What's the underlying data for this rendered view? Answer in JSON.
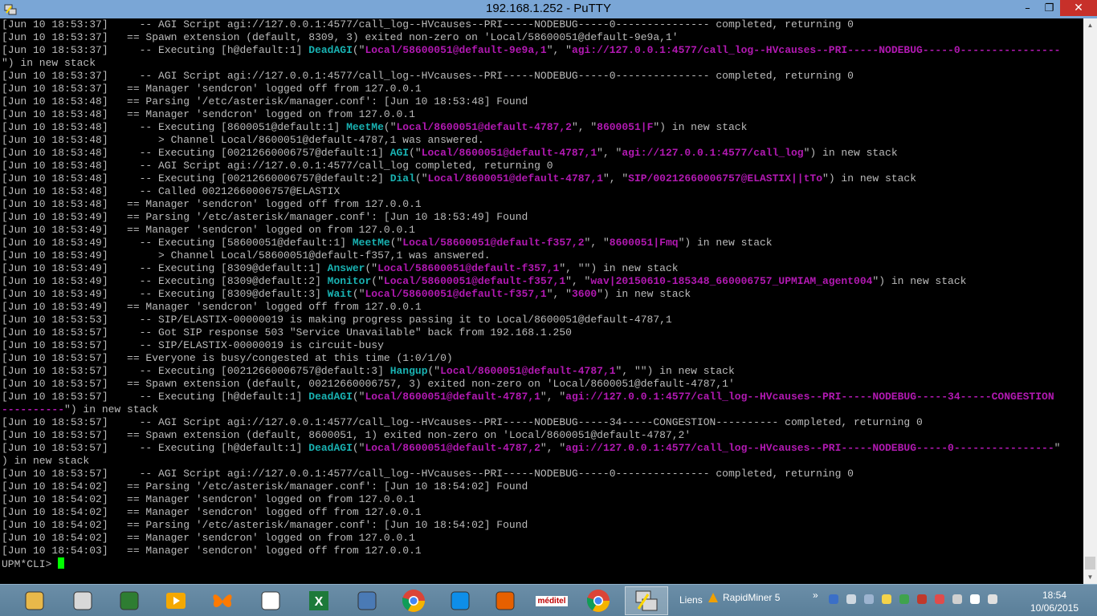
{
  "window": {
    "title": "192.168.1.252 - PuTTY"
  },
  "controls": {
    "minimize": "–",
    "restore": "❐",
    "close": "✕"
  },
  "colors": {
    "keyword": "#19b2b2",
    "argument": "#b219b2",
    "text": "#bbbbbb",
    "cursor": "#00ff00"
  },
  "terminal": {
    "prompt": "UPM*CLI> ",
    "lines": [
      [
        [
          "t",
          "[Jun 10 18:53:37]     -- AGI Script agi://127.0.0.1:4577/call_log--HVcauses--PRI-----NODEBUG-----0--------------- completed, returning 0"
        ]
      ],
      [
        [
          "t",
          "[Jun 10 18:53:37]   == Spawn extension (default, 8309, 3) exited non-zero on 'Local/58600051@default-9e9a,1'"
        ]
      ],
      [
        [
          "t",
          "[Jun 10 18:53:37]     -- Executing [h@default:1] "
        ],
        [
          "k",
          "DeadAGI"
        ],
        [
          "t",
          "(\""
        ],
        [
          "a",
          "Local/58600051@default-9e9a,1"
        ],
        [
          "t",
          "\", \""
        ],
        [
          "a",
          "agi://127.0.0.1:4577/call_log--HVcauses--PRI-----NODEBUG-----0----------------"
        ]
      ],
      [
        [
          "t",
          "\") in new stack"
        ]
      ],
      [
        [
          "t",
          "[Jun 10 18:53:37]     -- AGI Script agi://127.0.0.1:4577/call_log--HVcauses--PRI-----NODEBUG-----0--------------- completed, returning 0"
        ]
      ],
      [
        [
          "t",
          "[Jun 10 18:53:37]   == Manager 'sendcron' logged off from 127.0.0.1"
        ]
      ],
      [
        [
          "t",
          "[Jun 10 18:53:48]   == Parsing '/etc/asterisk/manager.conf': [Jun 10 18:53:48] Found"
        ]
      ],
      [
        [
          "t",
          "[Jun 10 18:53:48]   == Manager 'sendcron' logged on from 127.0.0.1"
        ]
      ],
      [
        [
          "t",
          "[Jun 10 18:53:48]     -- Executing [8600051@default:1] "
        ],
        [
          "k",
          "MeetMe"
        ],
        [
          "t",
          "(\""
        ],
        [
          "a",
          "Local/8600051@default-4787,2"
        ],
        [
          "t",
          "\", \""
        ],
        [
          "a",
          "8600051|F"
        ],
        [
          "t",
          "\") in new stack"
        ]
      ],
      [
        [
          "t",
          "[Jun 10 18:53:48]        > Channel Local/8600051@default-4787,1 was answered."
        ]
      ],
      [
        [
          "t",
          "[Jun 10 18:53:48]     -- Executing [00212660006757@default:1] "
        ],
        [
          "k",
          "AGI"
        ],
        [
          "t",
          "(\""
        ],
        [
          "a",
          "Local/8600051@default-4787,1"
        ],
        [
          "t",
          "\", \""
        ],
        [
          "a",
          "agi://127.0.0.1:4577/call_log"
        ],
        [
          "t",
          "\") in new stack"
        ]
      ],
      [
        [
          "t",
          "[Jun 10 18:53:48]     -- AGI Script agi://127.0.0.1:4577/call_log completed, returning 0"
        ]
      ],
      [
        [
          "t",
          "[Jun 10 18:53:48]     -- Executing [00212660006757@default:2] "
        ],
        [
          "k",
          "Dial"
        ],
        [
          "t",
          "(\""
        ],
        [
          "a",
          "Local/8600051@default-4787,1"
        ],
        [
          "t",
          "\", \""
        ],
        [
          "a",
          "SIP/00212660006757@ELASTIX||tTo"
        ],
        [
          "t",
          "\") in new stack"
        ]
      ],
      [
        [
          "t",
          "[Jun 10 18:53:48]     -- Called 00212660006757@ELASTIX"
        ]
      ],
      [
        [
          "t",
          "[Jun 10 18:53:48]   == Manager 'sendcron' logged off from 127.0.0.1"
        ]
      ],
      [
        [
          "t",
          "[Jun 10 18:53:49]   == Parsing '/etc/asterisk/manager.conf': [Jun 10 18:53:49] Found"
        ]
      ],
      [
        [
          "t",
          "[Jun 10 18:53:49]   == Manager 'sendcron' logged on from 127.0.0.1"
        ]
      ],
      [
        [
          "t",
          "[Jun 10 18:53:49]     -- Executing [58600051@default:1] "
        ],
        [
          "k",
          "MeetMe"
        ],
        [
          "t",
          "(\""
        ],
        [
          "a",
          "Local/58600051@default-f357,2"
        ],
        [
          "t",
          "\", \""
        ],
        [
          "a",
          "8600051|Fmq"
        ],
        [
          "t",
          "\") in new stack"
        ]
      ],
      [
        [
          "t",
          "[Jun 10 18:53:49]        > Channel Local/58600051@default-f357,1 was answered."
        ]
      ],
      [
        [
          "t",
          "[Jun 10 18:53:49]     -- Executing [8309@default:1] "
        ],
        [
          "k",
          "Answer"
        ],
        [
          "t",
          "(\""
        ],
        [
          "a",
          "Local/58600051@default-f357,1"
        ],
        [
          "t",
          "\", \"\") in new stack"
        ]
      ],
      [
        [
          "t",
          "[Jun 10 18:53:49]     -- Executing [8309@default:2] "
        ],
        [
          "k",
          "Monitor"
        ],
        [
          "t",
          "(\""
        ],
        [
          "a",
          "Local/58600051@default-f357,1"
        ],
        [
          "t",
          "\", \""
        ],
        [
          "a",
          "wav|20150610-185348_660006757_UPMIAM_agent004"
        ],
        [
          "t",
          "\") in new stack"
        ]
      ],
      [
        [
          "t",
          "[Jun 10 18:53:49]     -- Executing [8309@default:3] "
        ],
        [
          "k",
          "Wait"
        ],
        [
          "t",
          "(\""
        ],
        [
          "a",
          "Local/58600051@default-f357,1"
        ],
        [
          "t",
          "\", \""
        ],
        [
          "a",
          "3600"
        ],
        [
          "t",
          "\") in new stack"
        ]
      ],
      [
        [
          "t",
          "[Jun 10 18:53:49]   == Manager 'sendcron' logged off from 127.0.0.1"
        ]
      ],
      [
        [
          "t",
          "[Jun 10 18:53:53]     -- SIP/ELASTIX-00000019 is making progress passing it to Local/8600051@default-4787,1"
        ]
      ],
      [
        [
          "t",
          "[Jun 10 18:53:57]     -- Got SIP response 503 \"Service Unavailable\" back from 192.168.1.250"
        ]
      ],
      [
        [
          "t",
          "[Jun 10 18:53:57]     -- SIP/ELASTIX-00000019 is circuit-busy"
        ]
      ],
      [
        [
          "t",
          "[Jun 10 18:53:57]   == Everyone is busy/congested at this time (1:0/1/0)"
        ]
      ],
      [
        [
          "t",
          "[Jun 10 18:53:57]     -- Executing [00212660006757@default:3] "
        ],
        [
          "k",
          "Hangup"
        ],
        [
          "t",
          "(\""
        ],
        [
          "a",
          "Local/8600051@default-4787,1"
        ],
        [
          "t",
          "\", \"\") in new stack"
        ]
      ],
      [
        [
          "t",
          "[Jun 10 18:53:57]   == Spawn extension (default, 00212660006757, 3) exited non-zero on 'Local/8600051@default-4787,1'"
        ]
      ],
      [
        [
          "t",
          "[Jun 10 18:53:57]     -- Executing [h@default:1] "
        ],
        [
          "k",
          "DeadAGI"
        ],
        [
          "t",
          "(\""
        ],
        [
          "a",
          "Local/8600051@default-4787,1"
        ],
        [
          "t",
          "\", \""
        ],
        [
          "a",
          "agi://127.0.0.1:4577/call_log--HVcauses--PRI-----NODEBUG-----34-----CONGESTION"
        ]
      ],
      [
        [
          "a",
          "----------"
        ],
        [
          "t",
          "\") in new stack"
        ]
      ],
      [
        [
          "t",
          "[Jun 10 18:53:57]     -- AGI Script agi://127.0.0.1:4577/call_log--HVcauses--PRI-----NODEBUG-----34-----CONGESTION---------- completed, returning 0"
        ]
      ],
      [
        [
          "t",
          "[Jun 10 18:53:57]   == Spawn extension (default, 8600051, 1) exited non-zero on 'Local/8600051@default-4787,2'"
        ]
      ],
      [
        [
          "t",
          "[Jun 10 18:53:57]     -- Executing [h@default:1] "
        ],
        [
          "k",
          "DeadAGI"
        ],
        [
          "t",
          "(\""
        ],
        [
          "a",
          "Local/8600051@default-4787,2"
        ],
        [
          "t",
          "\", \""
        ],
        [
          "a",
          "agi://127.0.0.1:4577/call_log--HVcauses--PRI-----NODEBUG-----0----------------"
        ],
        [
          "t",
          "\""
        ]
      ],
      [
        [
          "t",
          ") in new stack"
        ]
      ],
      [
        [
          "t",
          "[Jun 10 18:53:57]     -- AGI Script agi://127.0.0.1:4577/call_log--HVcauses--PRI-----NODEBUG-----0--------------- completed, returning 0"
        ]
      ],
      [
        [
          "t",
          "[Jun 10 18:54:02]   == Parsing '/etc/asterisk/manager.conf': [Jun 10 18:54:02] Found"
        ]
      ],
      [
        [
          "t",
          "[Jun 10 18:54:02]   == Manager 'sendcron' logged on from 127.0.0.1"
        ]
      ],
      [
        [
          "t",
          "[Jun 10 18:54:02]   == Manager 'sendcron' logged off from 127.0.0.1"
        ]
      ],
      [
        [
          "t",
          "[Jun 10 18:54:02]   == Parsing '/etc/asterisk/manager.conf': [Jun 10 18:54:02] Found"
        ]
      ],
      [
        [
          "t",
          "[Jun 10 18:54:02]   == Manager 'sendcron' logged on from 127.0.0.1"
        ]
      ],
      [
        [
          "t",
          "[Jun 10 18:54:03]   == Manager 'sendcron' logged off from 127.0.0.1"
        ]
      ]
    ]
  },
  "taskbar": {
    "apps": [
      {
        "name": "file-explorer-icon",
        "color": "#e8b84a",
        "active": false
      },
      {
        "name": "paint-icon",
        "color": "#d8d8d8",
        "active": false
      },
      {
        "name": "monitor-chart-icon",
        "color": "#2e7d32",
        "active": false
      },
      {
        "name": "media-player-icon",
        "color": "#f5a800",
        "active": false
      },
      {
        "name": "butterfly-icon",
        "color": "#ff7a00",
        "active": false
      },
      {
        "name": "network-tool-icon",
        "color": "#ffffff",
        "active": false
      },
      {
        "name": "excel-icon",
        "color": "#1d7a3a",
        "active": false
      },
      {
        "name": "remote-desktop-icon",
        "color": "#4a7ab5",
        "active": false
      },
      {
        "name": "chrome-icon",
        "color": "#4285f4",
        "active": false
      },
      {
        "name": "teamviewer-icon",
        "color": "#0e8ee9",
        "active": false
      },
      {
        "name": "firefox-icon",
        "color": "#e66000",
        "active": false
      },
      {
        "name": "meditel-icon",
        "color": "#c00000",
        "active": false
      },
      {
        "name": "chrome-icon-2",
        "color": "#4285f4",
        "active": false
      },
      {
        "name": "putty-icon",
        "color": "#3a5fa8",
        "active": true
      }
    ],
    "meditel_label": "méditel",
    "links_label": "Liens",
    "rapidminer_label": "RapidMiner 5",
    "overflow_label": "»",
    "clock": {
      "time": "18:54",
      "date": "10/06/2015"
    },
    "tray": [
      "bluetooth-icon",
      "network-icon",
      "display-icon",
      "lightbulb-icon",
      "checkmark-icon",
      "antivirus-icon",
      "update-icon",
      "flag-icon",
      "volume-icon",
      "power-icon"
    ]
  }
}
